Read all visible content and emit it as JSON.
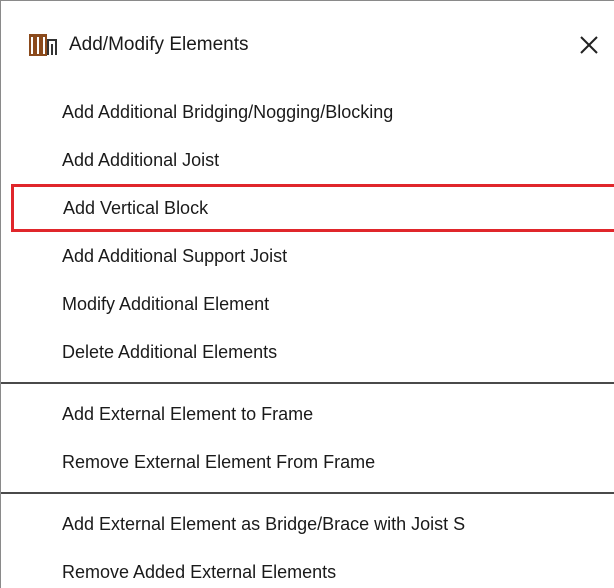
{
  "dialog": {
    "title": "Add/Modify Elements",
    "title_icon": "frame-elements-icon",
    "close_glyph": "×"
  },
  "menu": {
    "group1": [
      {
        "label": "Add Additional Bridging/Nogging/Blocking",
        "highlighted": false
      },
      {
        "label": "Add Additional Joist",
        "highlighted": false
      },
      {
        "label": "Add Vertical Block",
        "highlighted": true
      },
      {
        "label": "Add Additional Support Joist",
        "highlighted": false
      },
      {
        "label": "Modify Additional Element",
        "highlighted": false
      },
      {
        "label": "Delete Additional Elements",
        "highlighted": false
      }
    ],
    "group2": [
      {
        "label": "Add External Element to Frame",
        "highlighted": false
      },
      {
        "label": "Remove External Element From Frame",
        "highlighted": false
      }
    ],
    "group3": [
      {
        "label": "Add External Element as Bridge/Brace with Joist S",
        "highlighted": false
      },
      {
        "label": "Remove Added External Elements",
        "highlighted": false
      }
    ]
  },
  "colors": {
    "highlight_border": "#e0262b",
    "icon_brown": "#8b4a1c",
    "text": "#1a1a1a"
  }
}
